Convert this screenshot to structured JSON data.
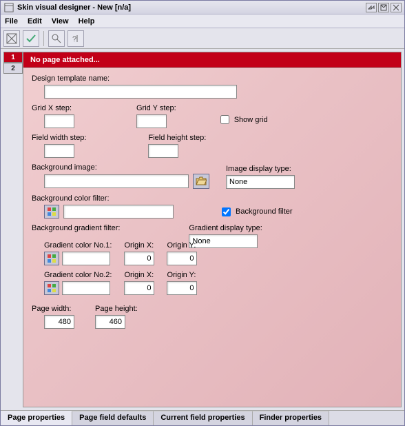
{
  "titlebar": {
    "title": "Skin visual designer - New [n/a]"
  },
  "menu": {
    "file": "File",
    "edit": "Edit",
    "view": "View",
    "help": "Help"
  },
  "page_tabs": [
    "1",
    "2"
  ],
  "banner": "No page attached...",
  "labels": {
    "design_template_name": "Design template name:",
    "grid_x_step": "Grid X step:",
    "grid_y_step": "Grid Y step:",
    "show_grid": "Show grid",
    "field_width_step": "Field width step:",
    "field_height_step": "Field height step:",
    "background_image": "Background image:",
    "image_display_type": "Image display type:",
    "background_color_filter": "Background color filter:",
    "background_filter": "Background filter",
    "background_gradient_filter": "Background gradient filter:",
    "gradient_display_type": "Gradient display type:",
    "gradient_color_1": "Gradient color No.1:",
    "gradient_color_2": "Gradient color No.2:",
    "origin_x": "Origin X:",
    "origin_y": "Origin Y:",
    "page_width": "Page width:",
    "page_height": "Page height:"
  },
  "values": {
    "design_template_name": "",
    "grid_x_step": "",
    "grid_y_step": "",
    "show_grid": false,
    "field_width_step": "",
    "field_height_step": "",
    "background_image": "",
    "image_display_type": "None",
    "background_color_filter": "",
    "background_filter": true,
    "gradient_display_type": "None",
    "grad1_color": "",
    "grad1_origin_x": "0",
    "grad1_origin_y": "0",
    "grad2_color": "",
    "grad2_origin_x": "0",
    "grad2_origin_y": "0",
    "page_width": "480",
    "page_height": "460"
  },
  "bottom_tabs": {
    "page_properties": "Page properties",
    "page_field_defaults": "Page field defaults",
    "current_field_properties": "Current field properties",
    "finder_properties": "Finder properties"
  }
}
